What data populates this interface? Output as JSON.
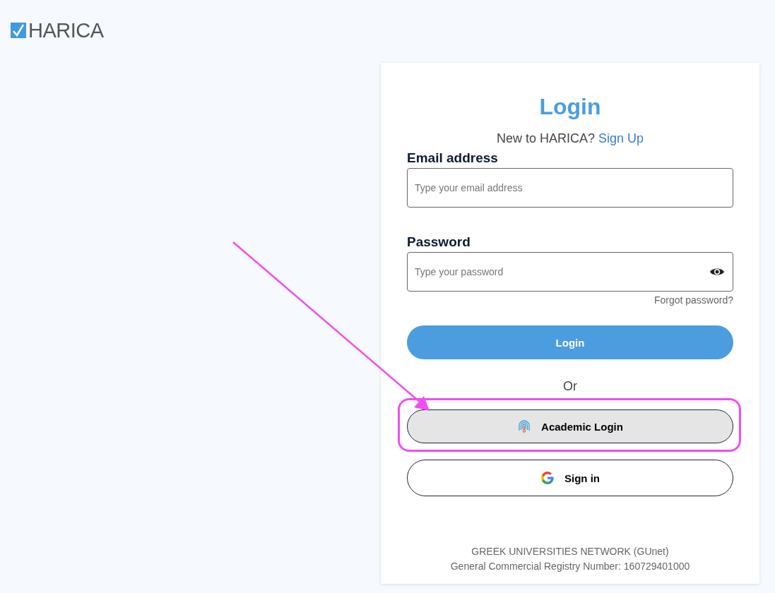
{
  "logo": {
    "text": "HARICA"
  },
  "card": {
    "title": "Login",
    "signup_prompt": "New to HARICA?",
    "signup_link": "Sign Up",
    "fields": [
      {
        "kind": "email",
        "label": "Email address",
        "placeholder": "Type your email address"
      },
      {
        "kind": "password",
        "label": "Password",
        "placeholder": "Type your password"
      }
    ],
    "forgot_link": "Forgot password?",
    "login_button": "Login",
    "divider_text": "Or",
    "buttons": [
      {
        "kind": "academic",
        "label": "Academic Login",
        "highlighted": true
      },
      {
        "kind": "google",
        "label": "Sign in",
        "highlighted": false
      }
    ],
    "footer": [
      "GREEK UNIVERSITIES NETWORK (GUnet)",
      "General Commercial Registry Number: 160729401000"
    ]
  }
}
